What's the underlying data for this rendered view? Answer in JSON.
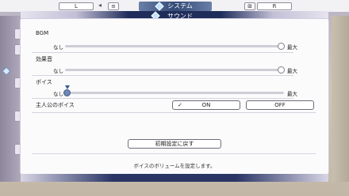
{
  "topbar": {
    "left_button": "L",
    "left_mini": "≡",
    "right_mini": "⊞",
    "right_button": "R",
    "title": "システム"
  },
  "panel": {
    "subtitle": "サウンド",
    "rows": [
      {
        "label": "BGM",
        "min": "なし",
        "max": "最大",
        "value_fraction": 1.0
      },
      {
        "label": "効果音",
        "min": "なし",
        "max": "最大",
        "value_fraction": 1.0
      },
      {
        "label": "ボイス",
        "min": "なし",
        "max": "最大",
        "value_fraction": 0.0
      }
    ],
    "protagonist_voice": {
      "label": "主人公のボイス",
      "on": "ON",
      "off": "OFF",
      "selected": "ON"
    },
    "reset_button": "初期設定に戻す",
    "description": "ボイスのボリュームを設定します。"
  },
  "icons": {
    "title": "diamond-icon",
    "subtitle": "diamond-icon",
    "check": "check-icon"
  }
}
